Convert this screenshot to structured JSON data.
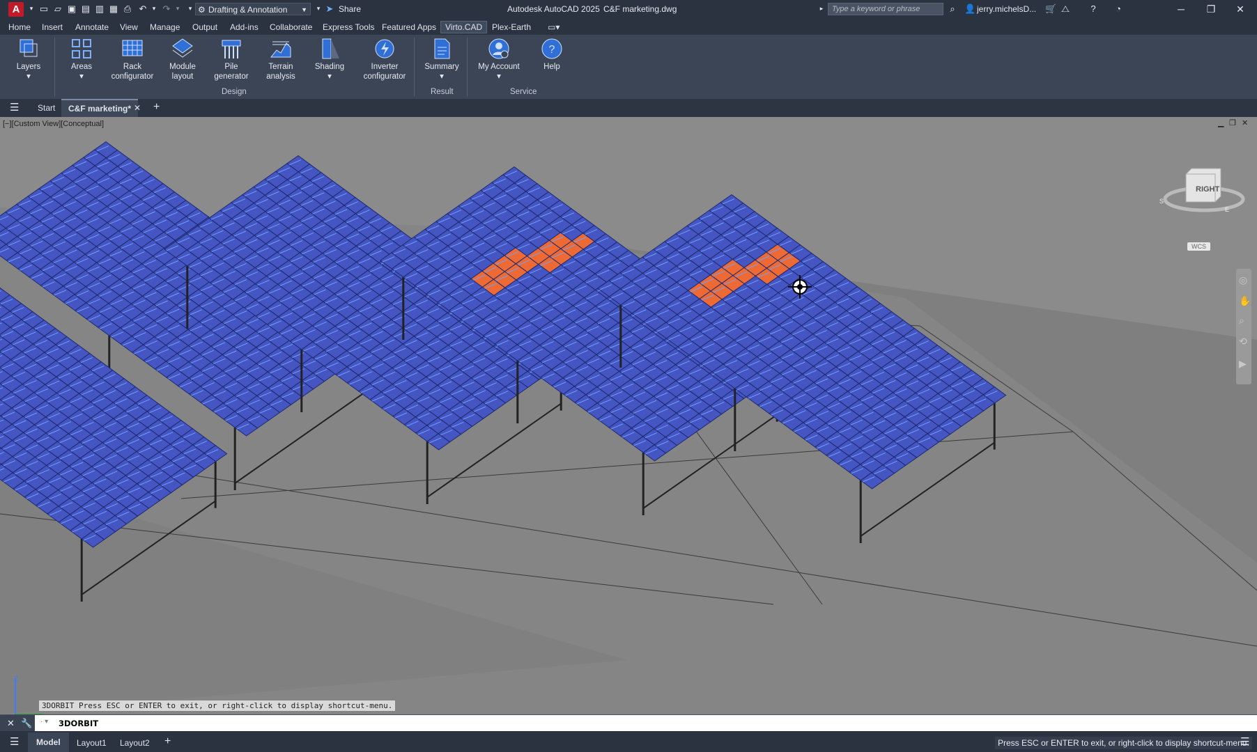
{
  "app": {
    "logo_letter": "A",
    "title": "Autodesk AutoCAD 2025",
    "document": "C&F marketing.dwg",
    "workspace": "Drafting & Annotation",
    "share_label": "Share",
    "search_placeholder": "Type a keyword or phrase",
    "user": "jerry.michelsD..."
  },
  "ribbon_tabs": [
    "Home",
    "Insert",
    "Annotate",
    "View",
    "Manage",
    "Output",
    "Add-ins",
    "Collaborate",
    "Express Tools",
    "Featured Apps",
    "Virto.CAD",
    "Plex-Earth"
  ],
  "active_ribbon_tab": "Virto.CAD",
  "ribbon": {
    "buttons": [
      {
        "label": "Layers",
        "icon": "layers-icon"
      },
      {
        "label": "Areas",
        "icon": "areas-icon"
      },
      {
        "label": "Rack configurator",
        "icon": "rack-icon"
      },
      {
        "label": "Module layout",
        "icon": "module-icon"
      },
      {
        "label": "Pile generator",
        "icon": "pile-icon"
      },
      {
        "label": "Terrain analysis",
        "icon": "terrain-icon"
      },
      {
        "label": "Shading",
        "icon": "shading-icon"
      },
      {
        "label": "Inverter configurator",
        "icon": "inverter-icon"
      },
      {
        "label": "Summary",
        "icon": "summary-icon"
      },
      {
        "label": "My Account",
        "icon": "account-icon"
      },
      {
        "label": "Help",
        "icon": "help-icon"
      }
    ],
    "panels": [
      "Design",
      "Result",
      "Service"
    ]
  },
  "file_tabs": {
    "start": "Start",
    "active": "C&F marketing*"
  },
  "viewport": {
    "label": "[−][Custom View][Conceptual]",
    "viewcube_face": "RIGHT",
    "wcs": "WCS",
    "colors": {
      "panel": "#4555c2",
      "highlight": "#ee6a35",
      "ground": "#858585"
    }
  },
  "command": {
    "history": "3DORBIT Press ESC or ENTER to exit, or right-click to display shortcut-menu.",
    "current": "3DORBIT"
  },
  "layout_tabs": [
    "Model",
    "Layout1",
    "Layout2"
  ],
  "status": {
    "message": "Press ESC or ENTER to exit, or right-click to display shortcut-menu."
  }
}
